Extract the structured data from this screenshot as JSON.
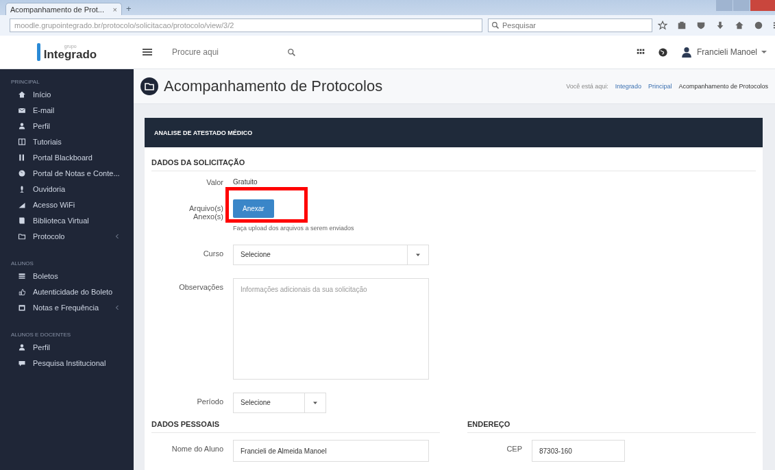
{
  "browser": {
    "tab_title": "Acompanhamento de Prot...",
    "tab_close": "×",
    "new_tab": "+",
    "url": "moodle.grupointegrado.br/protocolo/solicitacao/protocolo/view/3/2",
    "search_placeholder": "Pesquisar"
  },
  "header": {
    "logo_small": "grupo",
    "logo": "Integrado",
    "search_placeholder": "Procure aqui",
    "user": "Francieli Manoel"
  },
  "sidebar": [
    {
      "heading": "PRINCIPAL",
      "items": [
        {
          "label": "Início",
          "has_submenu": false
        },
        {
          "label": "E-mail",
          "has_submenu": false
        },
        {
          "label": "Perfil",
          "has_submenu": false
        },
        {
          "label": "Tutoriais",
          "has_submenu": false
        },
        {
          "label": "Portal Blackboard",
          "has_submenu": false
        },
        {
          "label": "Portal de Notas e Conte...",
          "has_submenu": false
        },
        {
          "label": "Ouvidoria",
          "has_submenu": false
        },
        {
          "label": "Acesso WiFi",
          "has_submenu": false
        },
        {
          "label": "Biblioteca Virtual",
          "has_submenu": false
        },
        {
          "label": "Protocolo",
          "has_submenu": true
        }
      ]
    },
    {
      "heading": "ALUNOS",
      "items": [
        {
          "label": "Boletos",
          "has_submenu": false
        },
        {
          "label": "Autenticidade do Boleto",
          "has_submenu": false
        },
        {
          "label": "Notas e Frequência",
          "has_submenu": true
        }
      ]
    },
    {
      "heading": "ALUNOS E DOCENTES",
      "items": [
        {
          "label": "Perfil",
          "has_submenu": false
        },
        {
          "label": "Pesquisa Institucional",
          "has_submenu": false
        }
      ]
    }
  ],
  "page": {
    "title": "Acompanhamento de Protocolos",
    "breadcrumb": [
      {
        "label": "Você está aqui:",
        "kind": "text"
      },
      {
        "label": "Integrado",
        "kind": "link"
      },
      {
        "label": "Principal",
        "kind": "link"
      },
      {
        "label": "Acompanhamento de Protocolos",
        "kind": "current"
      }
    ]
  },
  "card": {
    "title": "ANALISE DE ATESTADO MÉDICO",
    "request": {
      "heading": "DADOS DA SOLICITAÇÃO",
      "value_label": "Valor",
      "value": "Gratuito",
      "files_label": "Arquivo(s) Anexo(s)",
      "attach_button": "Anexar",
      "files_hint": "Faça upload dos arquivos a serem enviados",
      "course_label": "Curso",
      "course_value": "Selecione",
      "notes_label": "Observações",
      "notes_placeholder": "Informações adicionais da sua solicitação",
      "period_label": "Período",
      "period_value": "Selecione"
    },
    "personal": {
      "heading": "DADOS PESSOAIS",
      "name_label": "Nome do Aluno",
      "name_value": "Francieli de Almeida Manoel"
    },
    "address": {
      "heading": "ENDEREÇO",
      "cep_label": "CEP",
      "cep_value": "87303-160"
    }
  },
  "annotation": {
    "kind": "highlight",
    "color": "#ff0000"
  }
}
